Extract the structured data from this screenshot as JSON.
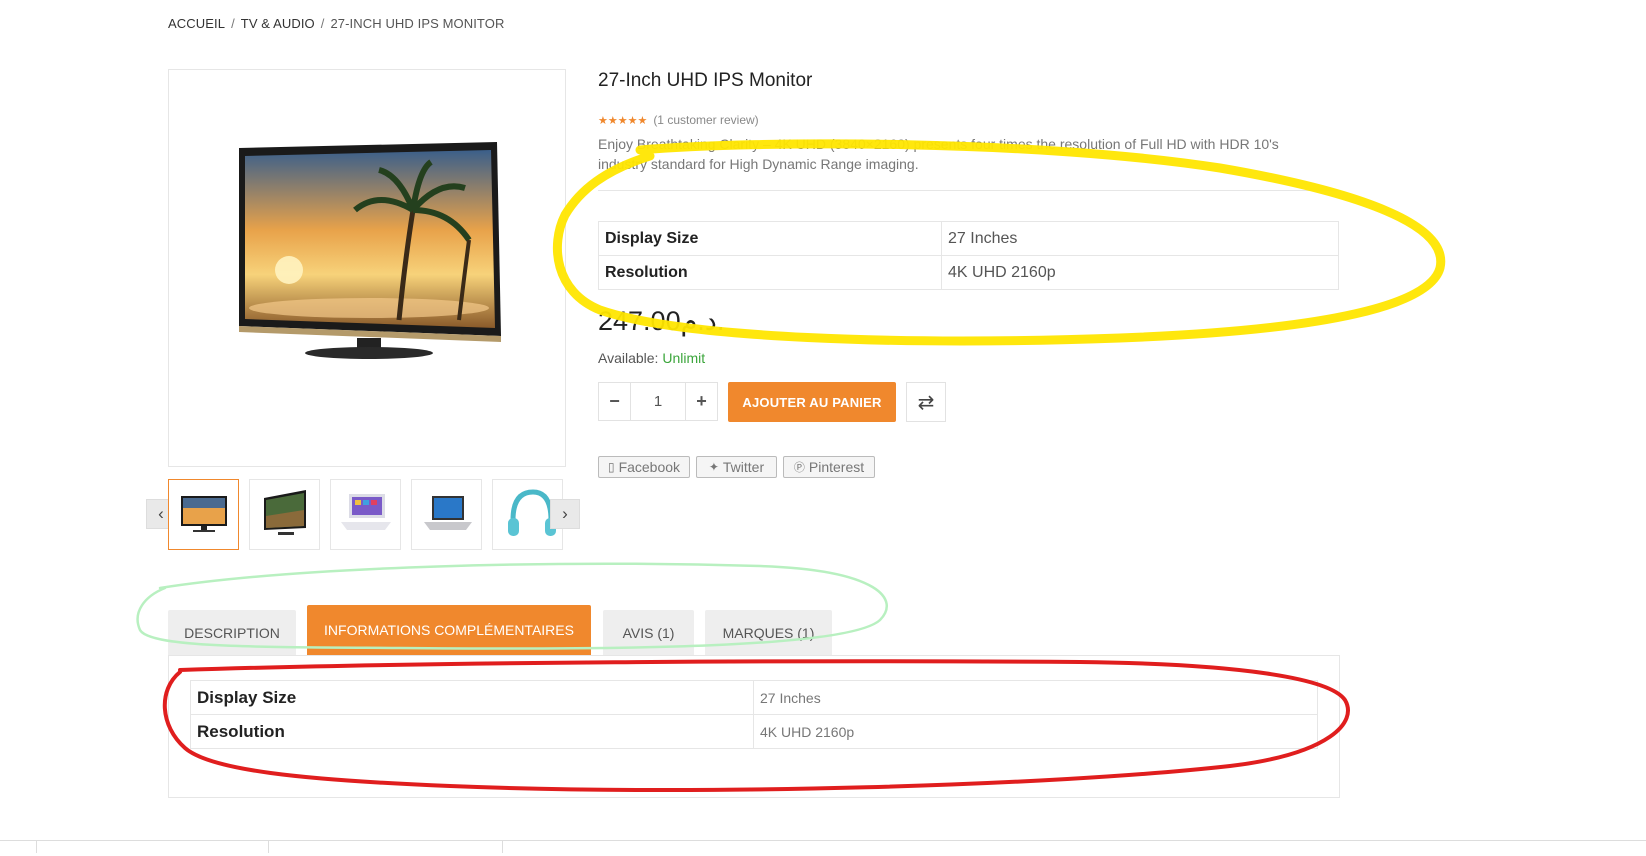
{
  "breadcrumb": {
    "home": "ACCUEIL",
    "category": "TV & AUDIO",
    "current": "27-INCH UHD IPS MONITOR",
    "separator": "/"
  },
  "product": {
    "title": "27-Inch UHD IPS Monitor",
    "stars": "★★★★★",
    "rating": 5,
    "review_link": "(1 customer review)",
    "description": "Enjoy Breathtaking Clarity – 4K UHD (3840×2160) presents four times the resolution of Full HD with HDR 10's industry standard for High Dynamic Range imaging.",
    "specs": [
      {
        "label": "Display Size",
        "value": "27 Inches"
      },
      {
        "label": "Resolution",
        "value": "4K UHD 2160p"
      }
    ],
    "price": "247.00د.م.",
    "availability_label": "Available:",
    "availability_value": "Unlimit",
    "quantity": "1",
    "add_to_cart": "AJOUTER AU PANIER"
  },
  "quantity_controls": {
    "minus": "−",
    "plus": "+"
  },
  "icons": {
    "prev": "chevron-left-icon",
    "next": "chevron-right-icon",
    "compare": "compare-arrows-icon"
  },
  "share": {
    "facebook": "Facebook",
    "twitter": "Twitter",
    "pinterest": "Pinterest"
  },
  "thumbnails": [
    "tv-monitor-thumbnail",
    "tv-forest-thumbnail",
    "laptop-white-thumbnail",
    "laptop-silver-thumbnail",
    "headphones-thumbnail"
  ],
  "tabs": [
    {
      "label": "DESCRIPTION",
      "active": false
    },
    {
      "label": "INFORMATIONS COMPLÉMENTAIRES",
      "active": true
    },
    {
      "label": "AVIS (1)",
      "active": false
    },
    {
      "label": "MARQUES (1)",
      "active": false
    }
  ],
  "additional_info": [
    {
      "label": "Display Size",
      "value": "27 Inches"
    },
    {
      "label": "Resolution",
      "value": "4K UHD 2160p"
    }
  ],
  "colors": {
    "accent": "#f0882d",
    "available": "#3ba53b",
    "annotation_yellow": "#ffe600",
    "annotation_green": "#b8f0c0",
    "annotation_red": "#e01e1e"
  }
}
